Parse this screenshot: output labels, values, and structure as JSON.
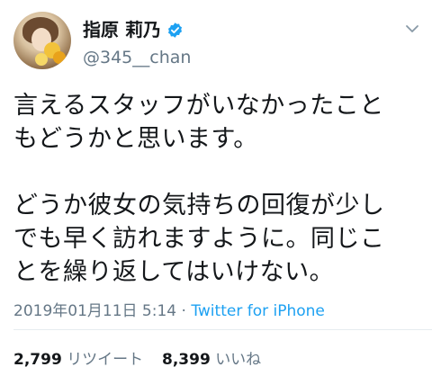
{
  "author": {
    "display_name": "指原 莉乃",
    "handle": "@345__chan",
    "verified": true
  },
  "tweet": {
    "lines": [
      "言えるスタッフがいなかったこと",
      "もどうかと思います。",
      "",
      "どうか彼女の気持ちの回復が少し",
      "でも早く訪れますように。同じこ",
      "とを繰り返してはいけない。"
    ]
  },
  "meta": {
    "timestamp": "2019年01月11日 5:14",
    "separator": " · ",
    "client": "Twitter for iPhone"
  },
  "stats": {
    "retweets_count": "2,799",
    "retweets_label": "リツイート",
    "likes_count": "8,399",
    "likes_label": "いいね"
  },
  "colors": {
    "link": "#1da1f2",
    "secondary_text": "#657786",
    "primary_text": "#14171a"
  },
  "icons": {
    "verified": "verified-badge-icon",
    "menu": "chevron-down-icon"
  }
}
